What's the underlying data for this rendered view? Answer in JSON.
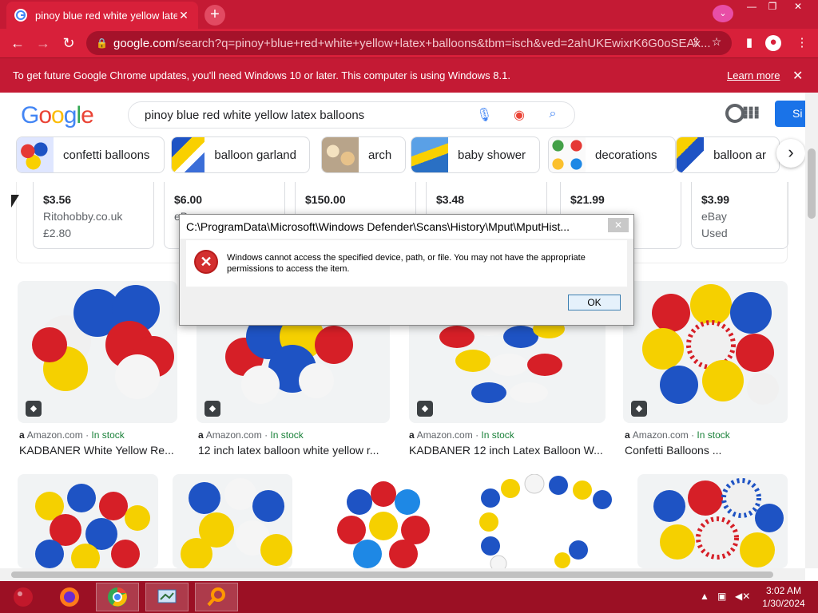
{
  "browser": {
    "tab_title": "pinoy blue red white yellow latex",
    "new_tab_symbol": "+",
    "url_host": "google.com",
    "url_path": "/search?q=pinoy+blue+red+white+yellow+latex+balloons&tbm=isch&ved=2ahUKEwixrK6G0oSEAx...",
    "infobar_text": "To get future Google Chrome updates, you'll need Windows 10 or later. This computer is using Windows 8.1.",
    "infobar_link": "Learn more",
    "accent": "#d8203a"
  },
  "google": {
    "logo": [
      "G",
      "o",
      "o",
      "g",
      "l",
      "e"
    ],
    "logo_colors": [
      "#4285f4",
      "#ea4335",
      "#fbbc05",
      "#4285f4",
      "#34a853",
      "#ea4335"
    ],
    "query": "pinoy blue red white yellow latex balloons",
    "signin_label": "Si",
    "chips": [
      {
        "label": "confetti balloons"
      },
      {
        "label": "balloon garland"
      },
      {
        "label": "arch"
      },
      {
        "label": "baby shower"
      },
      {
        "label": "decorations"
      },
      {
        "label": "balloon ar"
      }
    ],
    "product_cards": [
      {
        "price": "$3.56",
        "seller": "Ritohobby.co.uk",
        "sub": "£2.80"
      },
      {
        "price": "$6.00",
        "seller": "eB",
        "sub": ""
      },
      {
        "price": "$150.00",
        "seller": "",
        "sub": ""
      },
      {
        "price": "$3.48",
        "seller": "",
        "sub": ""
      },
      {
        "price": "$21.99",
        "seller": "",
        "sub": ""
      },
      {
        "price": "$3.99",
        "seller": "eBay",
        "sub": "Used"
      }
    ],
    "results": [
      {
        "source": "Amazon.com",
        "stock": "In stock",
        "title": "KADBANER White Yellow Re..."
      },
      {
        "source": "Amazon.com",
        "stock": "In stock",
        "title": "12 inch latex balloon white yellow r..."
      },
      {
        "source": "Amazon.com",
        "stock": "In stock",
        "title": "KADBANER 12 inch Latex Balloon W..."
      },
      {
        "source": "Amazon.com",
        "stock": "In stock",
        "title": "Confetti Balloons ..."
      }
    ],
    "source_separator": "·"
  },
  "dialog": {
    "title": "C:\\ProgramData\\Microsoft\\Windows Defender\\Scans\\History\\Mput\\MputHist...",
    "message": "Windows cannot access the specified device, path, or file. You may not have the appropriate permissions to access the item.",
    "ok_label": "OK",
    "close_symbol": "✕"
  },
  "taskbar": {
    "time": "3:02 AM",
    "date": "1/30/2024"
  }
}
